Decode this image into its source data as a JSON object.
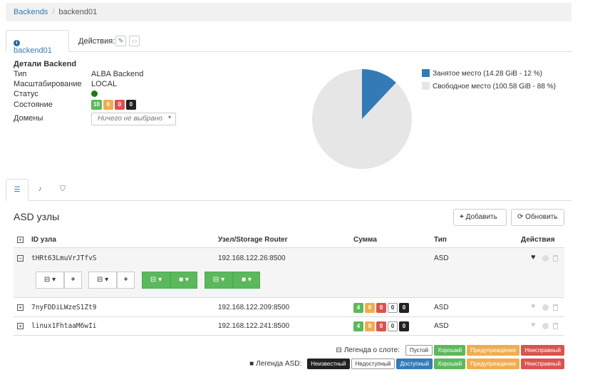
{
  "breadcrumb": {
    "root": "Backends",
    "current": "backend01"
  },
  "tabs": {
    "active": "backend01",
    "actions_label": "Действия:"
  },
  "details": {
    "title": "Детали Backend",
    "rows": [
      {
        "label": "Тип",
        "value": "ALBA Backend"
      },
      {
        "label": "Масштабирование",
        "value": "LOCAL"
      },
      {
        "label": "Статус",
        "value": ""
      },
      {
        "label": "Состояние",
        "value": ""
      },
      {
        "label": "Домены",
        "value": ""
      }
    ],
    "state_badges": [
      "10",
      "0",
      "0",
      "0"
    ],
    "domains_placeholder": "Ничего не выбрано"
  },
  "chart_data": {
    "type": "pie",
    "slices": [
      {
        "name": "Занятое место (14.28 GiB - 12 %)",
        "value": 12,
        "color": "#337ab7"
      },
      {
        "name": "Свободное место (100.58 GiB - 88 %)",
        "value": 88,
        "color": "#e6e6e6"
      }
    ],
    "legend_position": "top-right"
  },
  "asd": {
    "title": "ASD узлы",
    "add_label": "Добавить",
    "refresh_label": "Обновить",
    "columns": [
      "ID узла",
      "Узел/Storage Router",
      "Сумма",
      "Тип",
      "Действия"
    ],
    "rows": [
      {
        "id": "tHRt63LmuVrJTfvS",
        "router": "192.168.122.26:8500",
        "badges": [],
        "type": "ASD"
      },
      {
        "id": "7nyFDDiLWzeS1Zt9",
        "router": "192.168.122.209:8500",
        "badges": [
          "4",
          "0",
          "0",
          "0",
          "0"
        ],
        "type": "ASD"
      },
      {
        "id": "linux1FhtaaM6wIi",
        "router": "192.168.122.241:8500",
        "badges": [
          "4",
          "0",
          "0",
          "0",
          "0"
        ],
        "type": "ASD"
      }
    ]
  },
  "legend": {
    "slot_label": "Легенда о слоте:",
    "slot_items": [
      "Пустой",
      "Хороший",
      "Предупреждение",
      "Неисправный"
    ],
    "asd_label": "Легенда ASD:",
    "asd_items": [
      "Неизвестный",
      "Недоступный",
      "Доступный",
      "Хороший",
      "Предупреждение",
      "Неисправный"
    ]
  },
  "colors": {
    "accent": "#337ab7",
    "success": "#5cb85c",
    "warning": "#f0ad4e",
    "danger": "#d9534f"
  }
}
